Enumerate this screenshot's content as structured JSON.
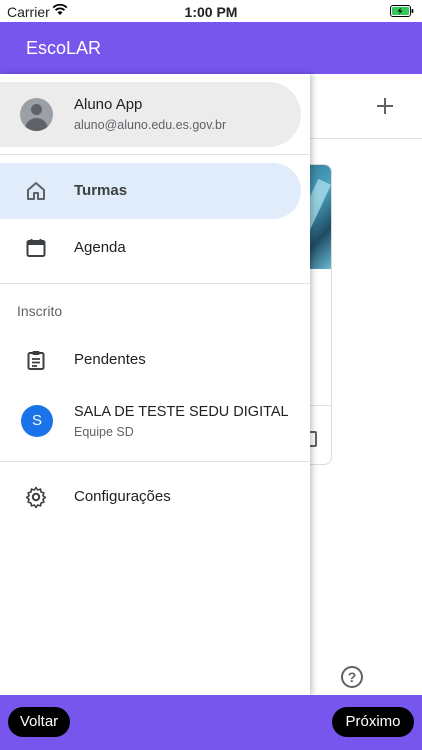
{
  "status_bar": {
    "carrier": "Carrier",
    "time": "1:00 PM"
  },
  "app_bar": {
    "title": "EscoLAR"
  },
  "drawer": {
    "account": {
      "name": "Aluno App",
      "email": "aluno@aluno.edu.es.gov.br"
    },
    "nav": [
      {
        "label": "Turmas",
        "icon": "home-icon",
        "active": true
      },
      {
        "label": "Agenda",
        "icon": "calendar-icon",
        "active": false
      }
    ],
    "section_header": "Inscrito",
    "enrolled": [
      {
        "label": "Pendentes",
        "icon": "clipboard-icon"
      }
    ],
    "classes": [
      {
        "initial": "S",
        "name": "SALA DE TESTE SEDU DIGITAL",
        "subtitle": "Equipe SD"
      }
    ],
    "settings": {
      "label": "Configurações",
      "icon": "gear-icon"
    }
  },
  "content": {
    "help_glyph": "?"
  },
  "bottom_bar": {
    "back_label": "Voltar",
    "next_label": "Próximo"
  },
  "colors": {
    "primary": "#7656ed",
    "active_nav_bg": "#e1ecfa",
    "class_avatar": "#1a73e8"
  }
}
